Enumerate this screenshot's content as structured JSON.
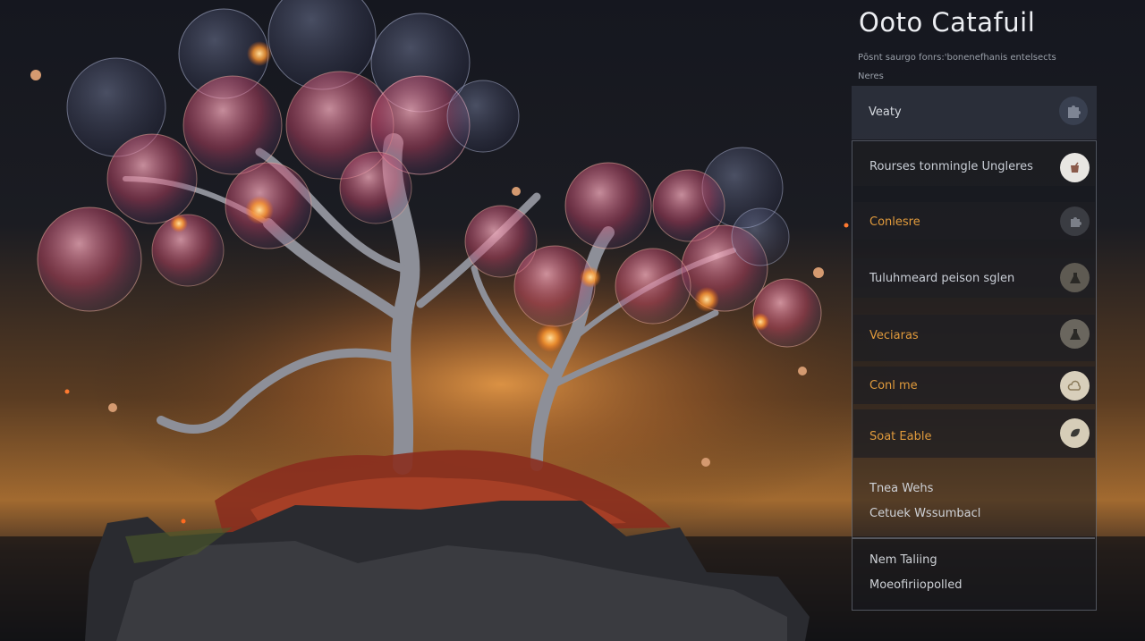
{
  "panel": {
    "title": "Ooto Catafuil",
    "subtitle_line1": "Pōsnt saurgo fonrs:'bonenefhanis entelsects",
    "subtitle_line2": "Neres",
    "top_card": {
      "label": "Veaty",
      "icon": "puzzle-icon"
    },
    "rows": [
      {
        "label": "Rourses tonmingle Ungleres",
        "icon": "cup-icon",
        "color": "#c9ced6",
        "icon_bg": "#e8e6e2"
      },
      {
        "label": "Conlesre",
        "icon": "puzzle-icon",
        "color": "#e09a3c",
        "icon_bg": "#3a3c42"
      },
      {
        "label": "Tuluhmeard peison sglen",
        "icon": "flask-icon",
        "color": "#c9ced6",
        "icon_bg": "#5e5a52"
      },
      {
        "label": "Veciaras",
        "icon": "flask-icon",
        "color": "#e09a3c",
        "icon_bg": "#6a665e"
      },
      {
        "label": "Conl me",
        "icon": "cloud-icon",
        "color": "#e09a3c",
        "icon_bg": "#d8cfbb"
      },
      {
        "label": "Soat Eable",
        "icon": "leaf-icon",
        "color": "#e09a3c",
        "icon_bg": "#d6cdb8"
      }
    ],
    "items": [
      {
        "label": "Tnea Wehs"
      },
      {
        "label": "Cetuek Wssumbacl"
      }
    ],
    "footer_items": [
      {
        "label": "Nem Taliing"
      },
      {
        "label": "Moeofiriiopolled"
      }
    ]
  }
}
